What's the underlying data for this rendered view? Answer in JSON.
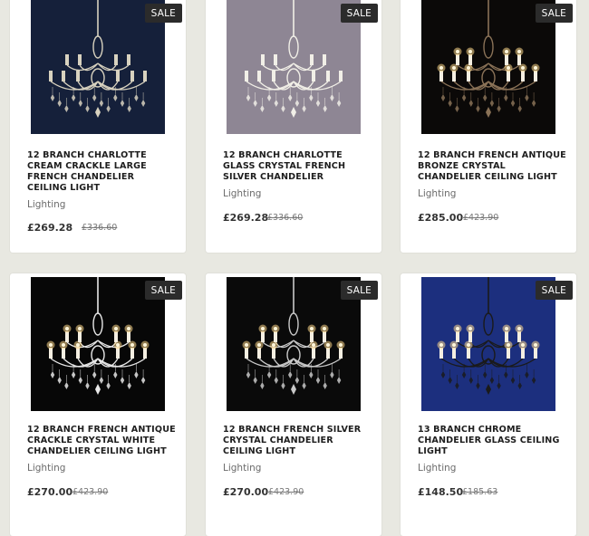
{
  "products": [
    {
      "title": "12 BRANCH CHARLOTTE CREAM CRACKLE LARGE FRENCH CHANDELIER CEILING LIGHT",
      "category": "Lighting",
      "price": "£269.28",
      "old_price": "£336.60",
      "badge": "SALE",
      "bg": "#15203a",
      "metal": "#d8d2bf",
      "glow": false
    },
    {
      "title": "12 BRANCH CHARLOTTE GLASS CRYSTAL FRENCH SILVER CHANDELIER",
      "category": "Lighting",
      "price": "£269.28",
      "old_price": "£336.60",
      "badge": "SALE",
      "bg": "#8e8694",
      "metal": "#f1efe7",
      "glow": false
    },
    {
      "title": "12 BRANCH FRENCH ANTIQUE BRONZE CRYSTAL CHANDELIER CEILING LIGHT",
      "category": "Lighting",
      "price": "£285.00",
      "old_price": "£423.90",
      "badge": "SALE",
      "bg": "#0b0908",
      "metal": "#8a7257",
      "glow": true
    },
    {
      "title": "12 BRANCH FRENCH ANTIQUE CRACKLE CRYSTAL WHITE CHANDELIER CEILING LIGHT",
      "category": "Lighting",
      "price": "£270.00",
      "old_price": "£423.90",
      "badge": "SALE",
      "bg": "#070707",
      "metal": "#e8e8e8",
      "glow": true
    },
    {
      "title": "12 BRANCH FRENCH SILVER CRYSTAL CHANDELIER CEILING LIGHT",
      "category": "Lighting",
      "price": "£270.00",
      "old_price": "£423.90",
      "badge": "SALE",
      "bg": "#0a0a0a",
      "metal": "#c9c9c9",
      "glow": true
    },
    {
      "title": "13 BRANCH CHROME CHANDELIER GLASS CEILING LIGHT",
      "category": "Lighting",
      "price": "£148.50",
      "old_price": "£185.63",
      "badge": "SALE",
      "bg": "#1c2f7e",
      "metal": "#1a1a1a",
      "glow": true
    }
  ]
}
